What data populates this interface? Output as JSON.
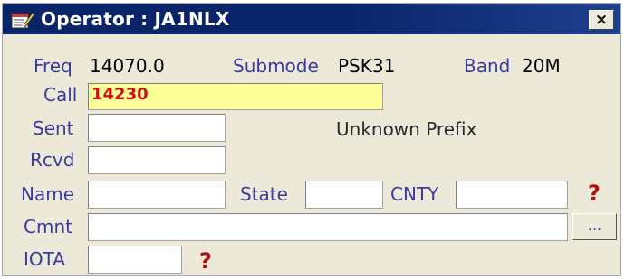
{
  "window": {
    "title": "Operator : JA1NLX",
    "close_label": "×"
  },
  "info": {
    "freq_label": "Freq",
    "freq_value": "14070.0",
    "submode_label": "Submode",
    "submode_value": "PSK31",
    "band_label": "Band",
    "band_value": "20M"
  },
  "fields": {
    "call_label": "Call",
    "call_value": "14230",
    "sent_label": "Sent",
    "sent_value": "",
    "rcvd_label": "Rcvd",
    "rcvd_value": "",
    "name_label": "Name",
    "name_value": "",
    "state_label": "State",
    "state_value": "",
    "cnty_label": "CNTY",
    "cnty_value": "",
    "cmnt_label": "Cmnt",
    "cmnt_value": "",
    "iota_label": "IOTA",
    "iota_value": ""
  },
  "status": {
    "prefix_text": "Unknown Prefix"
  },
  "buttons": {
    "more_label": "..."
  },
  "markers": {
    "cnty_help": "?",
    "iota_help": "?"
  },
  "colors": {
    "titlebar": "#0a246a",
    "label_text": "#3a3aa0",
    "call_bg": "#ffff99",
    "call_text": "#d01010",
    "help_mark": "#b01010"
  },
  "icons": {
    "title_icon": "notepad-pencil-icon",
    "close_icon": "close-icon"
  }
}
